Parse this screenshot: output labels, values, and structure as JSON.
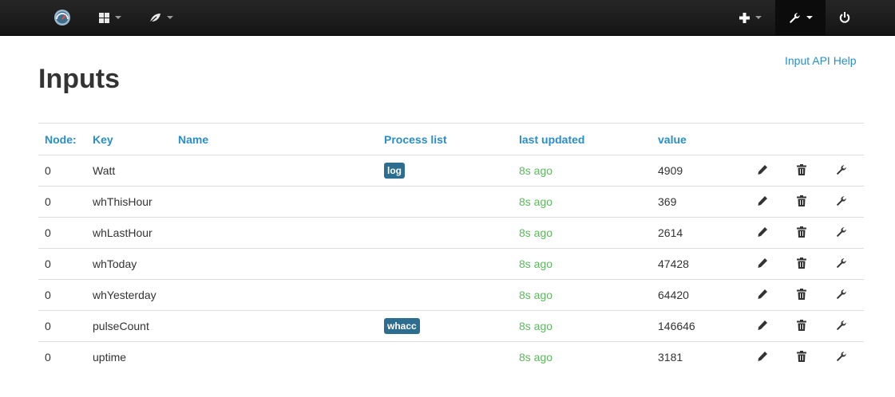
{
  "navbar": {
    "items": [
      {
        "name": "emoncms-logo-icon"
      },
      {
        "name": "dashboard-grid-icon"
      },
      {
        "name": "leaf-icon"
      },
      {
        "name": "plus-icon"
      },
      {
        "name": "wrench-icon"
      },
      {
        "name": "power-icon"
      }
    ]
  },
  "page": {
    "title": "Inputs",
    "api_help_link": "Input API Help"
  },
  "table": {
    "headers": {
      "node": "Node:",
      "key": "Key",
      "name": "Name",
      "process_list": "Process list",
      "last_updated": "last updated",
      "value": "value"
    },
    "rows": [
      {
        "node": "0",
        "key": "Watt",
        "name": "",
        "process": "log",
        "updated": "8s ago",
        "value": "4909"
      },
      {
        "node": "0",
        "key": "whThisHour",
        "name": "",
        "process": "",
        "updated": "8s ago",
        "value": "369"
      },
      {
        "node": "0",
        "key": "whLastHour",
        "name": "",
        "process": "",
        "updated": "8s ago",
        "value": "2614"
      },
      {
        "node": "0",
        "key": "whToday",
        "name": "",
        "process": "",
        "updated": "8s ago",
        "value": "47428"
      },
      {
        "node": "0",
        "key": "whYesterday",
        "name": "",
        "process": "",
        "updated": "8s ago",
        "value": "64420"
      },
      {
        "node": "0",
        "key": "pulseCount",
        "name": "",
        "process": "whacc",
        "updated": "8s ago",
        "value": "146646"
      },
      {
        "node": "0",
        "key": "uptime",
        "name": "",
        "process": "",
        "updated": "8s ago",
        "value": "3181"
      }
    ],
    "row_icons": [
      "pencil-icon",
      "trash-icon",
      "wrench-icon"
    ]
  },
  "colors": {
    "link": "#2a8ec8",
    "updated_ok": "#5cb85c",
    "badge": "#2d6d8f",
    "navbar": "#1b1b1b"
  }
}
